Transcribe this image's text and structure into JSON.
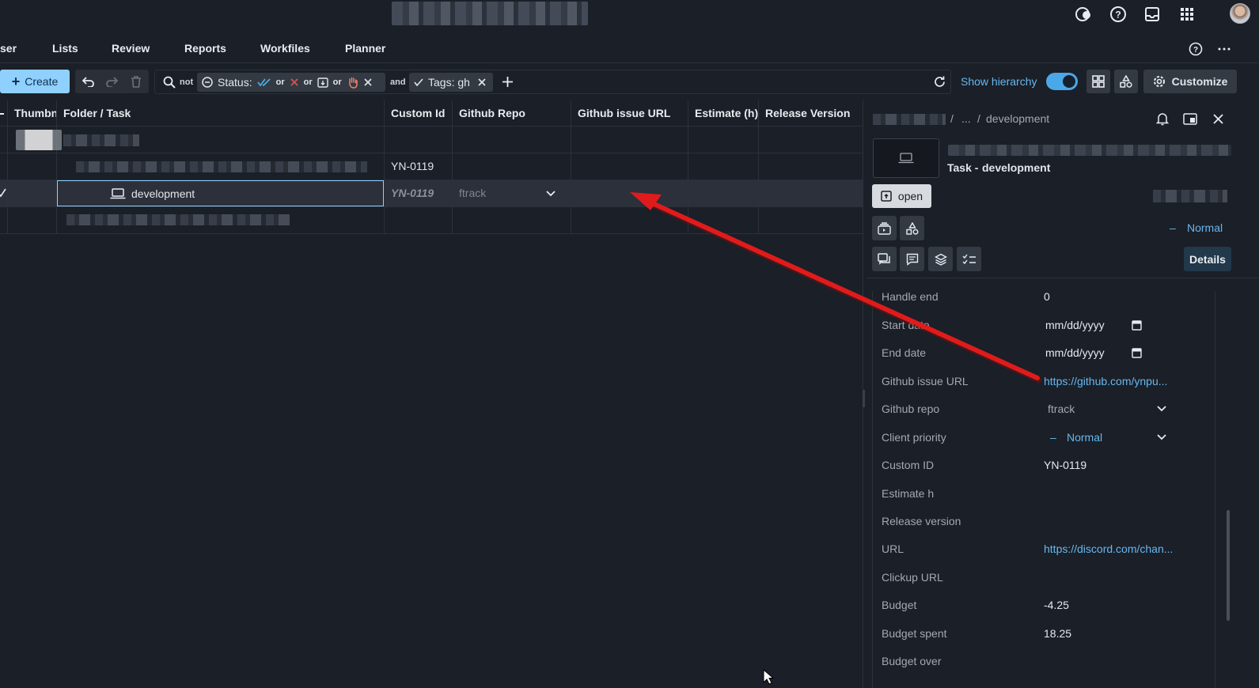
{
  "nav": {
    "items": [
      "ser",
      "Lists",
      "Review",
      "Reports",
      "Workfiles",
      "Planner"
    ]
  },
  "toolbar": {
    "create_label": "Create",
    "filter": {
      "not_label": "not",
      "status_label": "Status:",
      "or_label": "or",
      "and_label": "and",
      "tags_label": "Tags: gh"
    },
    "show_hierarchy_label": "Show hierarchy",
    "customize_label": "Customize"
  },
  "table": {
    "columns": [
      "Thumbn",
      "Folder / Task",
      "Custom Id",
      "Github Repo",
      "Github issue URL",
      "Estimate (h)",
      "Release Version"
    ],
    "rows": [
      {
        "custom_id": ""
      },
      {
        "custom_id": "YN-0119"
      },
      {
        "task": "development",
        "custom_id": "YN-0119",
        "github_repo": "ftrack"
      },
      {
        "custom_id": ""
      }
    ]
  },
  "panel": {
    "breadcrumb": {
      "ellipsis": "...",
      "separator": "/",
      "current": "development"
    },
    "task_type": "Task -",
    "task_name": "development",
    "open_label": "open",
    "priority": {
      "dash": "–",
      "label": "Normal"
    },
    "details_label": "Details",
    "fields": [
      {
        "label": "Handle end",
        "value": "0"
      },
      {
        "label": "Start date",
        "value": "mm/dd/yyyy"
      },
      {
        "label": "End date",
        "value": "mm/dd/yyyy"
      },
      {
        "label": "Github issue URL",
        "value": "https://github.com/ynpu..."
      },
      {
        "label": "Github repo",
        "value": "ftrack"
      },
      {
        "label": "Client priority",
        "value": "Normal"
      },
      {
        "label": "Custom ID",
        "value": "YN-0119"
      },
      {
        "label": "Estimate h",
        "value": ""
      },
      {
        "label": "Release version",
        "value": ""
      },
      {
        "label": "URL",
        "value": "https://discord.com/chan..."
      },
      {
        "label": "Clickup URL",
        "value": ""
      },
      {
        "label": "Budget",
        "value": "-4.25"
      },
      {
        "label": "Budget spent",
        "value": "18.25"
      },
      {
        "label": "Budget over",
        "value": ""
      }
    ]
  },
  "colors": {
    "accent": "#8fd0ff",
    "link": "#67b7ef",
    "annotation_arrow": "#e01b1b",
    "background": "#1b1f27"
  }
}
